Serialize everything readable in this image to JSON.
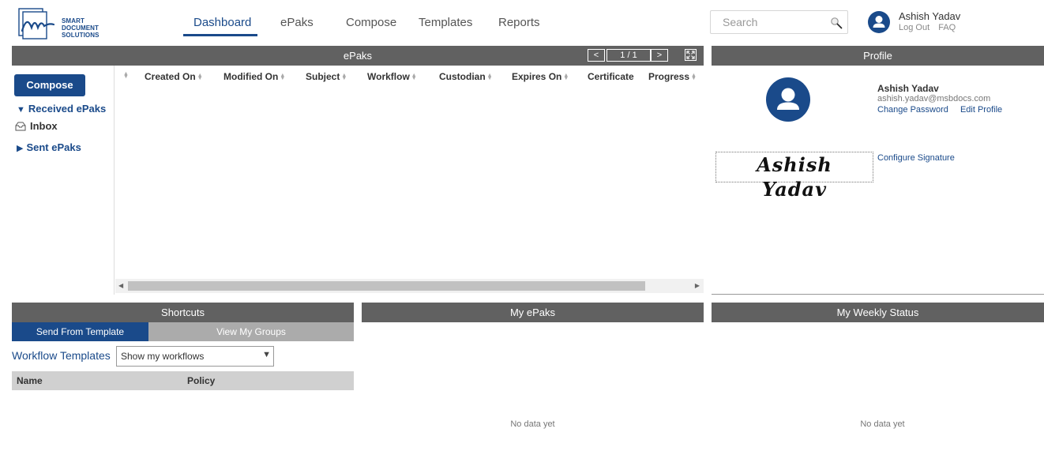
{
  "brand": {
    "line1": "SMART DOCUMENT",
    "line2": "SOLUTIONS"
  },
  "nav": {
    "dashboard": "Dashboard",
    "epaks": "ePaks",
    "compose": "Compose",
    "templates": "Templates",
    "reports": "Reports"
  },
  "search": {
    "placeholder": "Search"
  },
  "user": {
    "name": "Ashish Yadav",
    "logout": "Log Out",
    "faq": "FAQ"
  },
  "epaks_panel": {
    "title": "ePaks",
    "pager": {
      "prev": "<",
      "page": "1 / 1",
      "next": ">"
    },
    "compose_button": "Compose",
    "received": "Received ePaks",
    "inbox": "Inbox",
    "sent": "Sent ePaks",
    "columns": [
      "Created On",
      "Modified On",
      "Subject",
      "Workflow",
      "Custodian",
      "Expires On",
      "Certificate",
      "Progress"
    ]
  },
  "profile": {
    "title": "Profile",
    "name": "Ashish Yadav",
    "email": "ashish.yadav@msbdocs.com",
    "change_password": "Change Password",
    "edit_profile": "Edit Profile",
    "signature": "Ashish Yadav",
    "configure_signature": "Configure Signature"
  },
  "shortcuts": {
    "title": "Shortcuts",
    "tab_active": "Send From Template",
    "tab_inactive": "View My Groups",
    "workflow_label": "Workflow Templates",
    "workflow_select": "Show my workflows",
    "col_name": "Name",
    "col_policy": "Policy"
  },
  "my_epaks": {
    "title": "My ePaks",
    "empty": "No data yet"
  },
  "weekly": {
    "title": "My Weekly Status",
    "empty": "No data yet"
  },
  "colors": {
    "brand": "#1a4a8a",
    "bar": "#616161",
    "tab_inactive": "#ababab"
  }
}
